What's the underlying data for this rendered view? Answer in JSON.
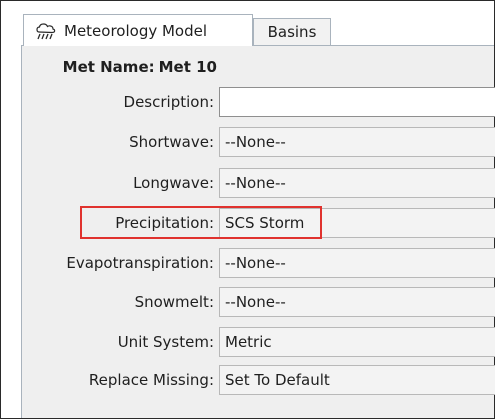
{
  "tabs": [
    {
      "label": "Meteorology Model",
      "icon": "meteorology-icon",
      "active": true
    },
    {
      "label": "Basins",
      "active": false
    }
  ],
  "met_name": {
    "label": "Met Name:",
    "value": "Met 10"
  },
  "fields": {
    "description": {
      "label": "Description:",
      "value": ""
    },
    "shortwave": {
      "label": "Shortwave:",
      "value": "--None--"
    },
    "longwave": {
      "label": "Longwave:",
      "value": "--None--"
    },
    "precipitation": {
      "label": "Precipitation:",
      "value": "SCS Storm"
    },
    "evapotranspiration": {
      "label": "Evapotranspiration:",
      "value": "--None--"
    },
    "snowmelt": {
      "label": "Snowmelt:",
      "value": "--None--"
    },
    "unit_system": {
      "label": "Unit System:",
      "value": "Metric"
    },
    "replace_missing": {
      "label": "Replace Missing:",
      "value": "Set To Default"
    }
  },
  "colors": {
    "highlight": "#e0322e",
    "panel": "#efefef",
    "tab_border": "#a9b3bd"
  }
}
